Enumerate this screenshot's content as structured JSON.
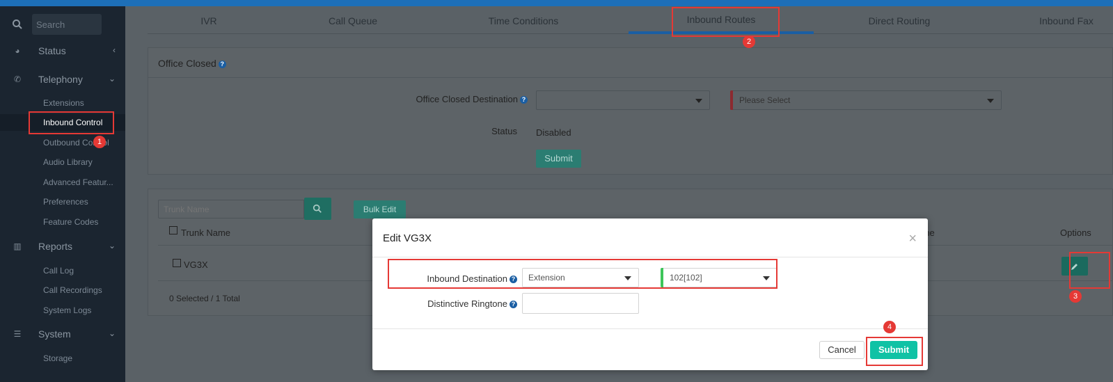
{
  "sidebar": {
    "search_placeholder": "Search",
    "groups": [
      {
        "label": "Status",
        "icon": "dashboard-icon"
      },
      {
        "label": "Telephony",
        "icon": "phone-icon"
      },
      {
        "label": "Reports",
        "icon": "bar-chart-icon"
      },
      {
        "label": "System",
        "icon": "list-icon"
      }
    ],
    "telephony_items": [
      "Extensions",
      "Inbound Control",
      "Outbound Control",
      "Audio Library",
      "Advanced Featur...",
      "Preferences",
      "Feature Codes"
    ],
    "reports_items": [
      "Call Log",
      "Call Recordings",
      "System Logs"
    ],
    "system_items": [
      "Storage"
    ]
  },
  "tabs": [
    "IVR",
    "Call Queue",
    "Time Conditions",
    "Inbound Routes",
    "Direct Routing",
    "Inbound Fax"
  ],
  "office_closed": {
    "title": "Office Closed",
    "destination_label": "Office Closed Destination",
    "destination_value": "",
    "second_select": "Please Select",
    "status_label": "Status",
    "status_value": "Disabled",
    "submit": "Submit"
  },
  "trunks": {
    "search_placeholder": "Trunk Name",
    "bulk_edit": "Bulk Edit",
    "col_trunk_name": "Trunk Name",
    "col_ringtone_partial": "one",
    "col_options": "Options",
    "rows": [
      {
        "name": "VG3X"
      }
    ],
    "footer": "0 Selected / 1 Total"
  },
  "modal": {
    "title": "Edit VG3X",
    "inbound_destination_label": "Inbound Destination",
    "inbound_type": "Extension",
    "inbound_value": "102[102]",
    "ringtone_label": "Distinctive Ringtone",
    "ringtone_value": "",
    "cancel": "Cancel",
    "submit": "Submit"
  },
  "annotations": [
    "1",
    "2",
    "3",
    "4"
  ],
  "colors": {
    "accent_teal": "#10c2a5",
    "annotation_red": "#e53935",
    "tab_active": "#1a5ea3"
  }
}
